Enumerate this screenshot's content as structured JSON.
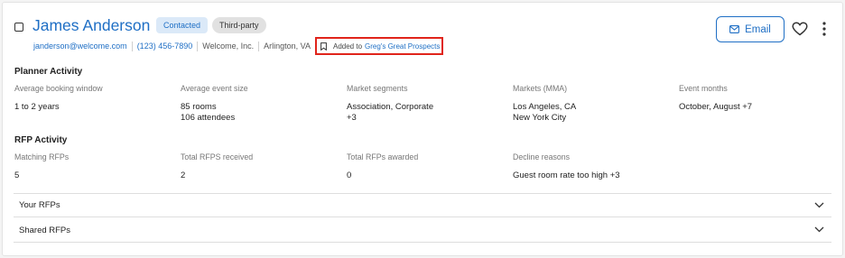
{
  "contact": {
    "name": "James Anderson",
    "badges": [
      "Contacted",
      "Third-party"
    ],
    "email": "janderson@welcome.com",
    "phone": "(123) 456-7890",
    "company": "Welcome, Inc.",
    "location": "Arlington, VA",
    "prospect_prefix": "Added to",
    "prospect_list": "Greg's Great Prospects"
  },
  "actions": {
    "email_label": "Email"
  },
  "planner_activity": {
    "title": "Planner Activity",
    "columns": [
      {
        "label": "Average booking window",
        "values": [
          "1 to 2 years"
        ]
      },
      {
        "label": "Average event size",
        "values": [
          "85 rooms",
          "106 attendees"
        ]
      },
      {
        "label": "Market segments",
        "values": [
          "Association, Corporate",
          "+3"
        ]
      },
      {
        "label": "Markets (MMA)",
        "values": [
          "Los Angeles, CA",
          "New York City"
        ]
      },
      {
        "label": "Event months",
        "values": [
          "October, August +7"
        ]
      }
    ]
  },
  "rfp_activity": {
    "title": "RFP Activity",
    "columns": [
      {
        "label": "Matching RFPs",
        "values": [
          "5"
        ]
      },
      {
        "label": "Total RFPS received",
        "values": [
          "2"
        ]
      },
      {
        "label": "Total RFPs awarded",
        "values": [
          "0"
        ]
      },
      {
        "label": "Decline reasons",
        "values": [
          "Guest room rate too high +3"
        ]
      }
    ]
  },
  "accordions": [
    {
      "label": "Your RFPs"
    },
    {
      "label": "Shared RFPs"
    }
  ],
  "icons": {
    "checkbox": "checkbox-icon",
    "bookmark": "bookmark-icon",
    "mail": "mail-icon",
    "heart": "heart-icon",
    "kebab": "kebab-menu-icon",
    "chevron": "chevron-down-icon"
  },
  "colors": {
    "accent": "#1f6fc5",
    "highlight_border": "#e0241b",
    "contacted_bg": "#dbe9f8",
    "thirdparty_bg": "#e1e1e1"
  }
}
